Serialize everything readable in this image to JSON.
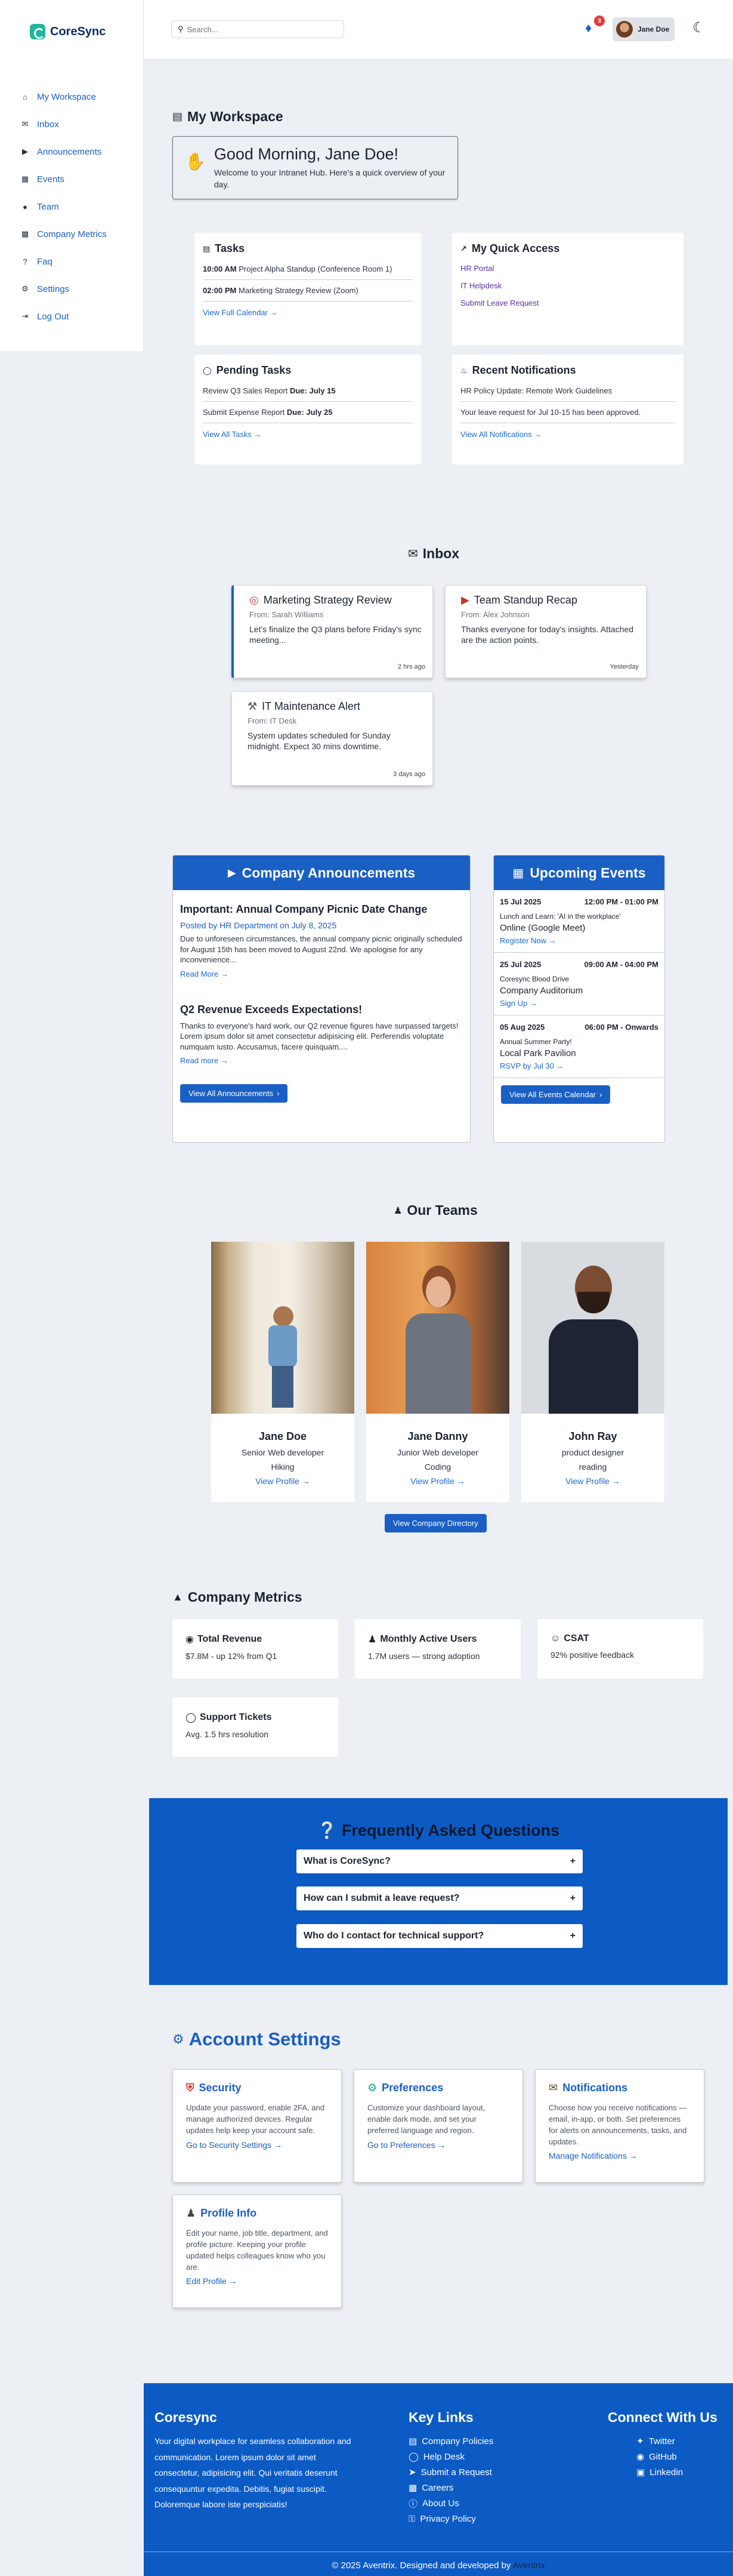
{
  "app": {
    "name": "CoreSync"
  },
  "sidebar": {
    "items": [
      {
        "label": "My Workspace",
        "icon": "home-icon"
      },
      {
        "label": "Inbox",
        "icon": "inbox-icon"
      },
      {
        "label": "Announcements",
        "icon": "megaphone-icon"
      },
      {
        "label": "Events",
        "icon": "calendar-icon"
      },
      {
        "label": "Team",
        "icon": "users-icon"
      },
      {
        "label": "Company Metrics",
        "icon": "bar-chart-icon"
      },
      {
        "label": "Faq",
        "icon": "question-icon"
      },
      {
        "label": "Settings",
        "icon": "gear-icon"
      },
      {
        "label": "Log Out",
        "icon": "logout-icon"
      }
    ]
  },
  "header": {
    "search_placeholder": "Search...",
    "notification_count": "3",
    "user_name": "Jane Doe"
  },
  "workspace": {
    "title": "My Workspace",
    "greeting": "Good Morning, Jane Doe!",
    "greeting_sub": "Welcome to your Intranet Hub. Here's a quick overview of your day.",
    "tasks": {
      "title": "Tasks",
      "items": [
        {
          "time": "10:00 AM",
          "text": "Project Alpha Standup (Conference Room 1)"
        },
        {
          "time": "02:00 PM",
          "text": "Marketing Strategy Review (Zoom)"
        }
      ],
      "link": "View Full Calendar →"
    },
    "quick_access": {
      "title": "My Quick Access",
      "links": [
        "HR Portal",
        "IT Helpdesk",
        "Submit Leave Request"
      ]
    },
    "pending": {
      "title": "Pending Tasks",
      "items": [
        {
          "text": "Review Q3 Sales Report",
          "due": "Due: July 15"
        },
        {
          "text": "Submit Expense Report",
          "due": "Due: July 25"
        }
      ],
      "link": "View All Tasks →"
    },
    "notifications": {
      "title": "Recent Notifications",
      "items": [
        "HR Policy Update: Remote Work Guidelines",
        "Your leave request for Jul 10-15 has been approved."
      ],
      "link": "View All Notifications →"
    }
  },
  "inbox": {
    "title": "Inbox",
    "messages": [
      {
        "subject": "Marketing Strategy Review",
        "from": "From: Sarah Williams",
        "body": "Let's finalize the Q3 plans before Friday's sync meeting...",
        "time": "2 hrs ago"
      },
      {
        "subject": "Team Standup Recap",
        "from": "From: Alex Johnson",
        "body": "Thanks everyone for today's insights. Attached are the action points.",
        "time": "Yesterday"
      },
      {
        "subject": "IT Maintenance Alert",
        "from": "From: IT Desk",
        "body": "System updates scheduled for Sunday midnight. Expect 30 mins downtime.",
        "time": "3 days ago"
      }
    ]
  },
  "announcements": {
    "title": "Company Announcements",
    "items": [
      {
        "title": "Important: Annual Company Picnic Date Change",
        "meta": "Posted by HR Department on July 8, 2025",
        "body": "Due to unforeseen circumstances, the annual company picnic originally scheduled for August 15th has been moved to August 22nd. We apologise for any inconvenience...",
        "link": "Read More →"
      },
      {
        "title": "Q2 Revenue Exceeds Expectations!",
        "meta": "",
        "body": "Thanks to everyone's hard work, our Q2 revenue figures have surpassed targets! Lorem ipsum dolor sit amet consectetur adipisicing elit. Perferendis voluptate numquam iusto. Accusamus, facere quisquam....",
        "link": "Read more →"
      }
    ],
    "button": "View All Announcements"
  },
  "events": {
    "title": "Upcoming Events",
    "items": [
      {
        "date": "15 Jul 2025",
        "time": "12:00 PM - 01:00 PM",
        "name": "Lunch and Learn: 'AI in the workplace'",
        "location": "Online (Google Meet)",
        "link": "Register Now →"
      },
      {
        "date": "25 Jul 2025",
        "time": "09:00 AM - 04:00 PM",
        "name": "Coresync Blood Drive",
        "location": "Company Auditorium",
        "link": "Sign Up →"
      },
      {
        "date": "05 Aug 2025",
        "time": "06:00 PM - Onwards",
        "name": "Annual Summer Party!",
        "location": "Local Park Pavilion",
        "link": "RSVP by Jul 30 →"
      }
    ],
    "button": "View All Events Calendar"
  },
  "teams": {
    "title": "Our Teams",
    "members": [
      {
        "name": "Jane Doe",
        "role": "Senior Web developer",
        "hobby": "Hiking",
        "link": "View Profile →"
      },
      {
        "name": "Jane Danny",
        "role": "Junior Web developer",
        "hobby": "Coding",
        "link": "View Profile →"
      },
      {
        "name": "John Ray",
        "role": "product designer",
        "hobby": "reading",
        "link": "View Profile →"
      }
    ],
    "button": "View Company Directory"
  },
  "metrics": {
    "title": "Company Metrics",
    "items": [
      {
        "label": "Total Revenue",
        "value": "$7.8M - up 12% from Q1"
      },
      {
        "label": "Monthly Active Users",
        "value": "1.7M users — strong adoption"
      },
      {
        "label": "CSAT",
        "value": "92% positive feedback"
      },
      {
        "label": "Support Tickets",
        "value": "Avg. 1.5 hrs resolution"
      }
    ]
  },
  "faq": {
    "title": "Frequently Asked Questions",
    "questions": [
      "What is CoreSync?",
      "How can I submit a leave request?",
      "Who do I contact for technical support?"
    ],
    "toggle": "+"
  },
  "settings": {
    "title": "Account Settings",
    "items": [
      {
        "title": "Security",
        "body": "Update your password, enable 2FA, and manage authorized devices. Regular updates help keep your account safe.",
        "link": "Go to Security Settings →"
      },
      {
        "title": "Preferences",
        "body": "Customize your dashboard layout, enable dark mode, and set your preferred language and region.",
        "link": "Go to Preferences →"
      },
      {
        "title": "Notifications",
        "body": "Choose how you receive notifications — email, in-app, or both. Set preferences for alerts on announcements, tasks, and updates.",
        "link": "Manage Notifications →"
      },
      {
        "title": "Profile Info",
        "body": "Edit your name, job title, department, and profile picture. Keeping your profile updated helps colleagues know who you are.",
        "link": "Edit Profile →"
      }
    ]
  },
  "footer": {
    "brand": "Coresync",
    "about": "Your digital workplace for seamless collaboration and communication. Lorem ipsum dolor sit amet consectetur, adipisicing elit. Qui veritatis deserunt consequuntur expedita. Debitis, fugiat suscipit. Doloremque labore iste perspiciatis!",
    "links_title": "Key Links",
    "links": [
      "Company Policies",
      "Help Desk",
      "Submit a Request",
      "Careers",
      "About Us",
      "Privacy Policy"
    ],
    "connect_title": "Connect With Us",
    "social": [
      "Twitter",
      "GitHub",
      "Linkedin"
    ],
    "copyright": "© 2025 Aventrix. Designed and developed by",
    "developer": "Aventrix"
  }
}
